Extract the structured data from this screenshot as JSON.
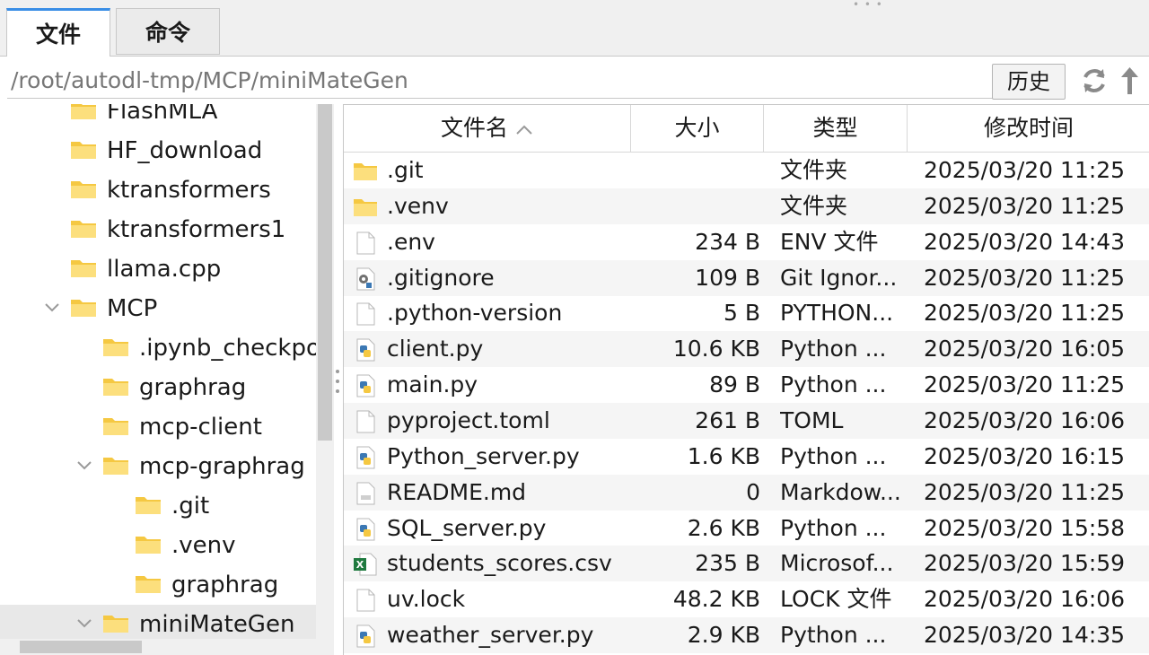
{
  "tabs": [
    {
      "label": "文件",
      "active": true
    },
    {
      "label": "命令",
      "active": false
    }
  ],
  "path": {
    "value": "/root/autodl-tmp/MCP/miniMateGen",
    "history_label": "历史"
  },
  "tree": {
    "items": [
      {
        "label": "FlashMLA",
        "level": 1,
        "expanded": null
      },
      {
        "label": "HF_download",
        "level": 1,
        "expanded": null
      },
      {
        "label": "ktransformers",
        "level": 1,
        "expanded": null
      },
      {
        "label": "ktransformers1",
        "level": 1,
        "expanded": null
      },
      {
        "label": "llama.cpp",
        "level": 1,
        "expanded": null
      },
      {
        "label": "MCP",
        "level": 1,
        "expanded": true
      },
      {
        "label": ".ipynb_checkpoi",
        "level": 2,
        "expanded": null
      },
      {
        "label": "graphrag",
        "level": 2,
        "expanded": null
      },
      {
        "label": "mcp-client",
        "level": 2,
        "expanded": null
      },
      {
        "label": "mcp-graphrag",
        "level": 2,
        "expanded": true
      },
      {
        "label": ".git",
        "level": 3,
        "expanded": null
      },
      {
        "label": ".venv",
        "level": 3,
        "expanded": null
      },
      {
        "label": "graphrag",
        "level": 3,
        "expanded": null
      },
      {
        "label": "miniMateGen",
        "level": 2,
        "expanded": true,
        "selected": true
      }
    ]
  },
  "table": {
    "headers": {
      "name": "文件名",
      "size": "大小",
      "type": "类型",
      "modified": "修改时间"
    },
    "sort": {
      "column": "name",
      "direction": "ascending"
    },
    "rows": [
      {
        "icon": "folder-icon",
        "name": ".git",
        "size": "",
        "type": "文件夹",
        "modified": "2025/03/20 11:25"
      },
      {
        "icon": "folder-icon",
        "name": ".venv",
        "size": "",
        "type": "文件夹",
        "modified": "2025/03/20 11:25"
      },
      {
        "icon": "blank-file-icon",
        "name": ".env",
        "size": "234 B",
        "type": "ENV 文件",
        "modified": "2025/03/20 14:43"
      },
      {
        "icon": "gear-file-icon",
        "name": ".gitignore",
        "size": "109 B",
        "type": "Git Ignor...",
        "modified": "2025/03/20 11:25"
      },
      {
        "icon": "blank-file-icon",
        "name": ".python-version",
        "size": "5 B",
        "type": "PYTHON...",
        "modified": "2025/03/20 11:25"
      },
      {
        "icon": "python-file-icon",
        "name": "client.py",
        "size": "10.6 KB",
        "type": "Python ...",
        "modified": "2025/03/20 16:05"
      },
      {
        "icon": "python-file-icon",
        "name": "main.py",
        "size": "89 B",
        "type": "Python ...",
        "modified": "2025/03/20 11:25"
      },
      {
        "icon": "blank-file-icon",
        "name": "pyproject.toml",
        "size": "261 B",
        "type": "TOML",
        "modified": "2025/03/20 16:06"
      },
      {
        "icon": "python-file-icon",
        "name": "Python_server.py",
        "size": "1.6 KB",
        "type": "Python ...",
        "modified": "2025/03/20 16:15"
      },
      {
        "icon": "markdown-file-icon",
        "name": "README.md",
        "size": "0",
        "type": "Markdow...",
        "modified": "2025/03/20 11:25"
      },
      {
        "icon": "python-file-icon",
        "name": "SQL_server.py",
        "size": "2.6 KB",
        "type": "Python ...",
        "modified": "2025/03/20 15:58"
      },
      {
        "icon": "excel-file-icon",
        "name": "students_scores.csv",
        "size": "235 B",
        "type": "Microsof...",
        "modified": "2025/03/20 15:59"
      },
      {
        "icon": "blank-file-icon",
        "name": "uv.lock",
        "size": "48.2 KB",
        "type": "LOCK 文件",
        "modified": "2025/03/20 16:06"
      },
      {
        "icon": "python-file-icon",
        "name": "weather_server.py",
        "size": "2.9 KB",
        "type": "Python ...",
        "modified": "2025/03/20 14:35"
      }
    ]
  },
  "colors": {
    "accent": "#3a8ee6",
    "folder": "#f5c842",
    "python_blue": "#3b78b4",
    "excel_green": "#1f7a3f"
  }
}
